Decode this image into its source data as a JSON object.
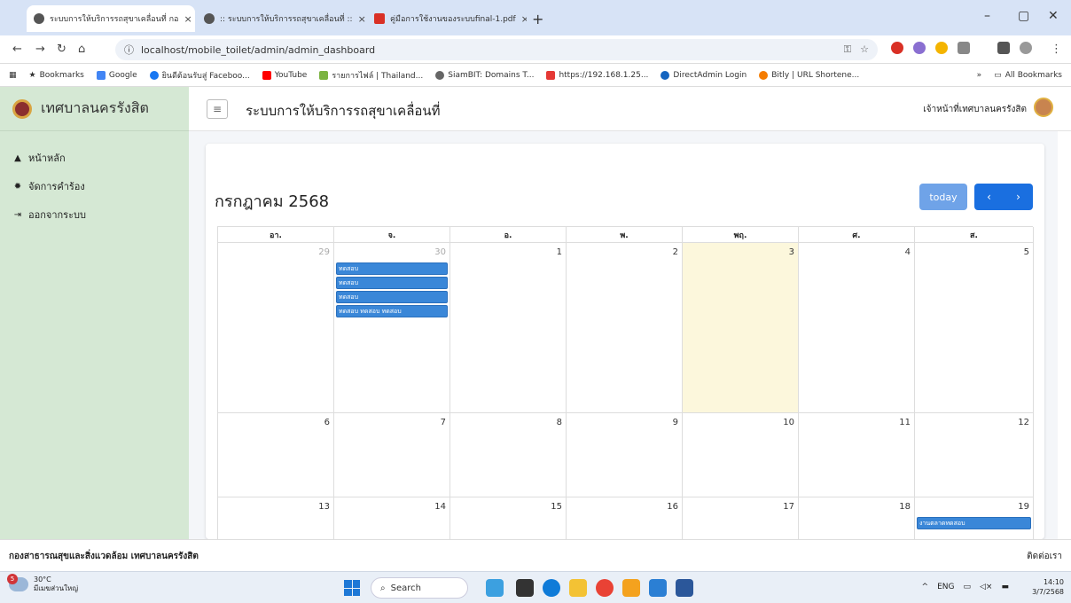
{
  "browser": {
    "tabs": [
      {
        "title": "ระบบการให้บริการรถสุขาเคลื่อนที่ กอ"
      },
      {
        "title": ":: ระบบการให้บริการรถสุขาเคลื่อนที่ ::"
      },
      {
        "title": "คู่มือการใช้งานของระบบfinal-1.pdf"
      }
    ],
    "url": "localhost/mobile_toilet/admin/admin_dashboard",
    "bookmarks": [
      "Bookmarks",
      "Google",
      "ยินดีต้อนรับสู่ Faceboo...",
      "YouTube",
      "รายการไฟล์ | Thailand...",
      "SiamBIT: Domains T...",
      "https://192.168.1.25...",
      "DirectAdmin Login",
      "Bitly | URL Shortene..."
    ],
    "all_bookmarks": "All Bookmarks"
  },
  "sidebar": {
    "brand": "เทศบาลนครรังสิต",
    "items": [
      {
        "label": "หน้าหลัก",
        "icon": "home-icon"
      },
      {
        "label": "จัดการคำร้อง",
        "icon": "gear-icon"
      },
      {
        "label": "ออกจากระบบ",
        "icon": "logout-icon"
      }
    ]
  },
  "header": {
    "title": "ระบบการให้บริการรถสุขาเคลื่อนที่",
    "user": "เจ้าหน้าที่เทศบาลนครรังสิต"
  },
  "calendar": {
    "month_label": "กรกฎาคม 2568",
    "today_label": "today",
    "days": [
      "อา.",
      "จ.",
      "อ.",
      "พ.",
      "พฤ.",
      "ศ.",
      "ส."
    ],
    "weeks": [
      [
        "29",
        "30",
        "1",
        "2",
        "3",
        "4",
        "5"
      ],
      [
        "6",
        "7",
        "8",
        "9",
        "10",
        "11",
        "12"
      ],
      [
        "13",
        "14",
        "15",
        "16",
        "17",
        "18",
        "19"
      ]
    ],
    "events_mon30": [
      "ทดสอบ",
      "ทดสอบ",
      "ทดสอบ",
      "ทดสอบ ทดสอบ ทดสอบ"
    ],
    "events_sat19": [
      "งานตลาดทดสอบ"
    ]
  },
  "footer": {
    "left": "กองสาธารณสุขและสิ่งแวดล้อม เทศบาลนครรังสิต",
    "right": "ติดต่อเรา"
  },
  "taskbar": {
    "temp": "30°C",
    "weather": "มีเมฆส่วนใหญ่",
    "badge": "5",
    "search": "Search",
    "lang": "ENG",
    "time": "14:10",
    "date": "3/7/2568"
  },
  "colors": {
    "sidebar": "#d5e8d4",
    "event": "#3a87d8",
    "today_bg": "#fcf7dc",
    "nav_button": "#1a6fe0"
  }
}
